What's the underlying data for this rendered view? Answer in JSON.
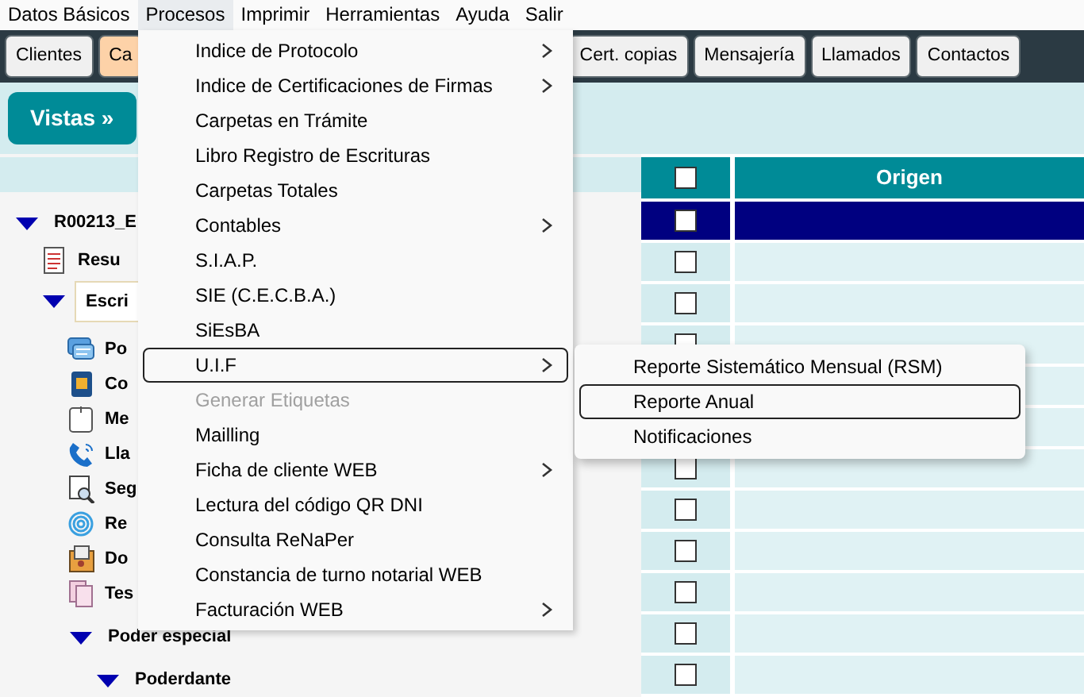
{
  "menubar": [
    {
      "label": "Datos Básicos",
      "selected": false
    },
    {
      "label": "Procesos",
      "selected": true
    },
    {
      "label": "Imprimir",
      "selected": false
    },
    {
      "label": "Herramientas",
      "selected": false
    },
    {
      "label": "Ayuda",
      "selected": false
    },
    {
      "label": "Salir",
      "selected": false
    }
  ],
  "toolbar": [
    {
      "label": "Clientes",
      "selected": false
    },
    {
      "label": "Ca",
      "selected": true
    },
    {
      "label": "Cert. copias",
      "selected": false
    },
    {
      "label": "Mensajería",
      "selected": false
    },
    {
      "label": "Llamados",
      "selected": false
    },
    {
      "label": "Contactos",
      "selected": false
    }
  ],
  "vistas_button": "Vistas »",
  "tree": [
    {
      "label": "R00213_E",
      "expanded": true,
      "children": [
        {
          "label": "Resu",
          "kind": "leaf"
        },
        {
          "label": "Escri",
          "expanded": true,
          "selected": true,
          "children": [
            {
              "label": "Po",
              "kind": "leaf"
            },
            {
              "label": "Co",
              "kind": "leaf"
            },
            {
              "label": "Me",
              "kind": "leaf"
            },
            {
              "label": "Lla",
              "kind": "leaf"
            },
            {
              "label": "Seg",
              "kind": "leaf"
            },
            {
              "label": "Re",
              "kind": "leaf"
            },
            {
              "label": "Do",
              "kind": "leaf"
            },
            {
              "label": "Tes",
              "kind": "leaf"
            },
            {
              "label": "Poder especial",
              "expanded": true,
              "children": [
                {
                  "label": "Poderdante",
                  "expanded": true
                }
              ]
            }
          ]
        }
      ]
    }
  ],
  "grid": {
    "columns": [
      "Origen"
    ],
    "header_checked": false,
    "rows": [
      {
        "selected": true,
        "checked": false
      },
      {
        "selected": false,
        "checked": false
      },
      {
        "selected": false,
        "checked": false
      },
      {
        "selected": false,
        "checked": false
      },
      {
        "selected": false
      },
      {
        "selected": false
      },
      {
        "selected": false,
        "checked": false
      },
      {
        "selected": false,
        "checked": false
      },
      {
        "selected": false,
        "checked": false
      },
      {
        "selected": false,
        "checked": false
      },
      {
        "selected": false,
        "checked": false
      },
      {
        "selected": false,
        "checked": false
      }
    ]
  },
  "menu": [
    {
      "label": "Indice de Protocolo",
      "submenu": true,
      "disabled": false,
      "selected": false
    },
    {
      "label": "Indice de Certificaciones de Firmas",
      "submenu": true,
      "disabled": false,
      "selected": false
    },
    {
      "label": "Carpetas en Trámite",
      "submenu": false,
      "disabled": false,
      "selected": false
    },
    {
      "label": "Libro Registro de Escrituras",
      "submenu": false,
      "disabled": false,
      "selected": false
    },
    {
      "label": "Carpetas Totales",
      "submenu": false,
      "disabled": false,
      "selected": false
    },
    {
      "label": "Contables",
      "submenu": true,
      "disabled": false,
      "selected": false
    },
    {
      "label": "S.I.A.P.",
      "submenu": false,
      "disabled": false,
      "selected": false
    },
    {
      "label": "SIE (C.E.C.B.A.)",
      "submenu": false,
      "disabled": false,
      "selected": false
    },
    {
      "label": "SiEsBA",
      "submenu": false,
      "disabled": false,
      "selected": false
    },
    {
      "label": "U.I.F",
      "submenu": true,
      "disabled": false,
      "selected": true
    },
    {
      "label": "Generar Etiquetas",
      "submenu": false,
      "disabled": true,
      "selected": false
    },
    {
      "label": "Mailling",
      "submenu": false,
      "disabled": false,
      "selected": false
    },
    {
      "label": "Ficha de cliente WEB",
      "submenu": true,
      "disabled": false,
      "selected": false
    },
    {
      "label": "Lectura del código QR DNI",
      "submenu": false,
      "disabled": false,
      "selected": false
    },
    {
      "label": "Consulta ReNaPer",
      "submenu": false,
      "disabled": false,
      "selected": false
    },
    {
      "label": "Constancia de turno notarial WEB",
      "submenu": false,
      "disabled": false,
      "selected": false
    },
    {
      "label": "Facturación WEB",
      "submenu": true,
      "disabled": false,
      "selected": false
    }
  ],
  "submenu": [
    {
      "label": "Reporte Sistemático Mensual (RSM)",
      "selected": false
    },
    {
      "label": "Reporte Anual",
      "selected": true
    },
    {
      "label": "Notificaciones",
      "selected": false
    }
  ]
}
